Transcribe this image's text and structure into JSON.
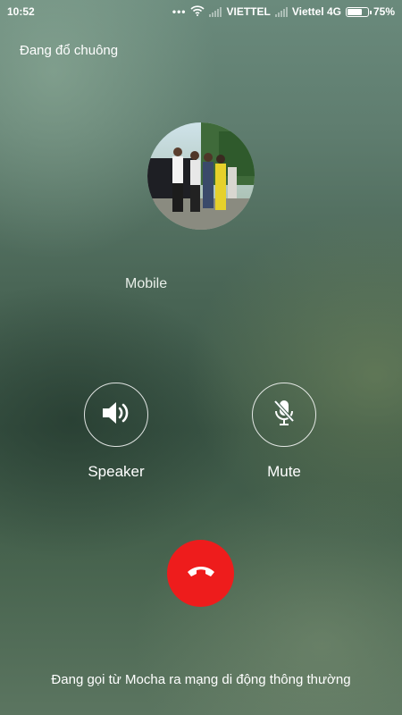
{
  "status_bar": {
    "time": "10:52",
    "overflow_dots": "•••",
    "carrier1": "VIETTEL",
    "carrier2": "Viettel 4G",
    "battery_percent_text": "75%",
    "battery_level": 0.75
  },
  "call": {
    "state": "Đang đổ chuông",
    "callee_label": "Mobile"
  },
  "controls": {
    "speaker_label": "Speaker",
    "mute_label": "Mute"
  },
  "footer": {
    "note": "Đang gọi từ Mocha ra mạng di động thông thường"
  },
  "colors": {
    "hangup": "#ee1c1c",
    "text": "#ffffff"
  }
}
